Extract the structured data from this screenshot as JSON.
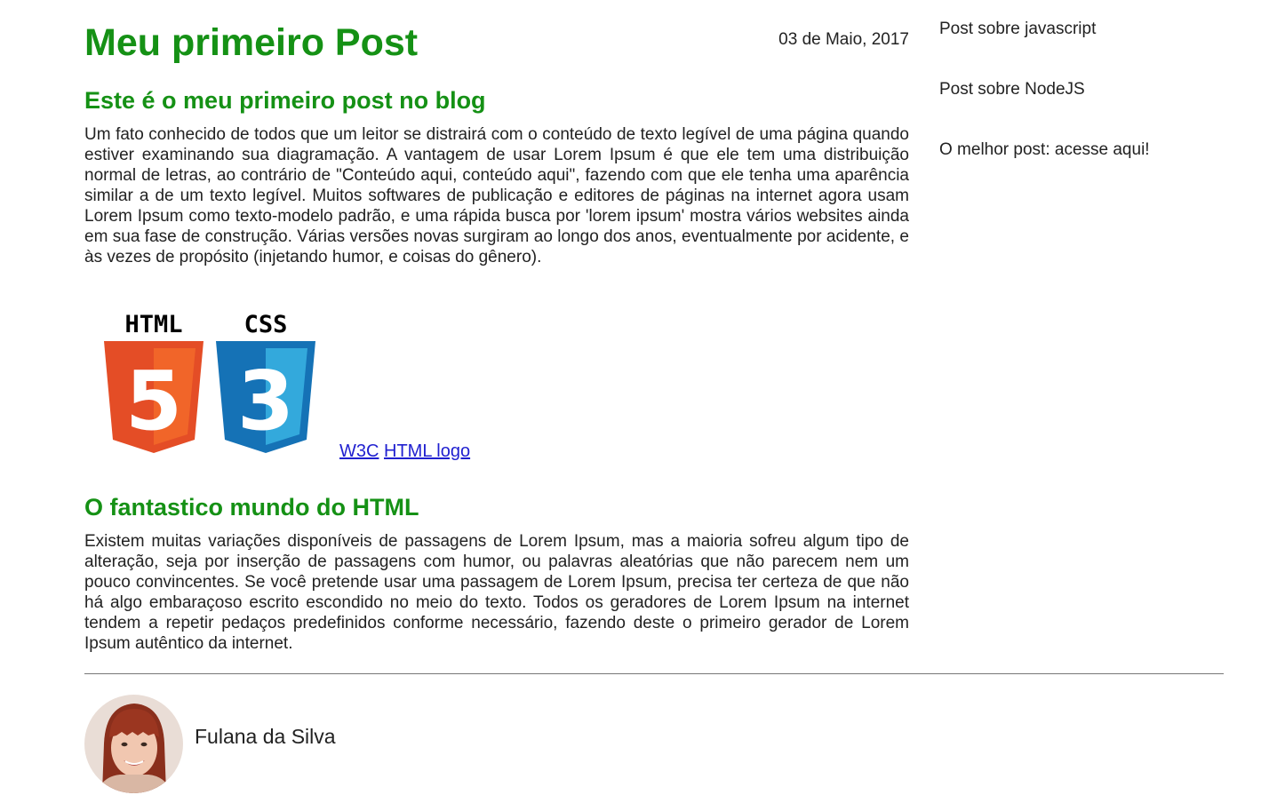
{
  "post": {
    "title": "Meu primeiro Post",
    "date": "03 de Maio, 2017",
    "section1_heading": "Este é o meu primeiro post no blog",
    "section1_text": "Um fato conhecido de todos que um leitor se distrairá com o conteúdo de texto legível de uma página quando estiver examinando sua diagramação. A vantagem de usar Lorem Ipsum é que ele tem uma distribuição normal de letras, ao contrário de \"Conteúdo aqui, conteúdo aqui\", fazendo com que ele tenha uma aparência similar a de um texto legível. Muitos softwares de publicação e editores de páginas na internet agora usam Lorem Ipsum como texto-modelo padrão, e uma rápida busca por 'lorem ipsum' mostra vários websites ainda em sua fase de construção. Várias versões novas surgiram ao longo dos anos, eventualmente por acidente, e às vezes de propósito (injetando humor, e coisas do gênero).",
    "section2_heading": "O fantastico mundo do HTML",
    "section2_text": "Existem muitas variações disponíveis de passagens de Lorem Ipsum, mas a maioria sofreu algum tipo de alteração, seja por inserção de passagens com humor, ou palavras aleatórias que não parecem nem um pouco convincentes. Se você pretende usar uma passagem de Lorem Ipsum, precisa ter certeza de que não há algo embaraçoso escrito escondido no meio do texto. Todos os geradores de Lorem Ipsum na internet tendem a repetir pedaços predefinidos conforme necessário, fazendo deste o primeiro gerador de Lorem Ipsum autêntico da internet."
  },
  "logos": {
    "html_label": "HTML",
    "html_number": "5",
    "css_label": "CSS",
    "css_number": "3",
    "link1": "W3C",
    "link2": "HTML logo"
  },
  "sidebar": {
    "items": [
      {
        "label": "Post sobre javascript"
      },
      {
        "label": "Post sobre NodeJS"
      },
      {
        "label": "O melhor post: acesse aqui!"
      }
    ]
  },
  "author": {
    "name": "Fulana da Silva"
  },
  "colors": {
    "heading": "#159115",
    "html_orange": "#e44d26",
    "html_orange_light": "#f16529",
    "css_blue": "#1572b6",
    "css_blue_light": "#33a9dc",
    "link": "#2020d0"
  },
  "icons": {
    "html_logo": "html5-logo-icon",
    "css_logo": "css3-logo-icon",
    "avatar": "author-avatar"
  }
}
